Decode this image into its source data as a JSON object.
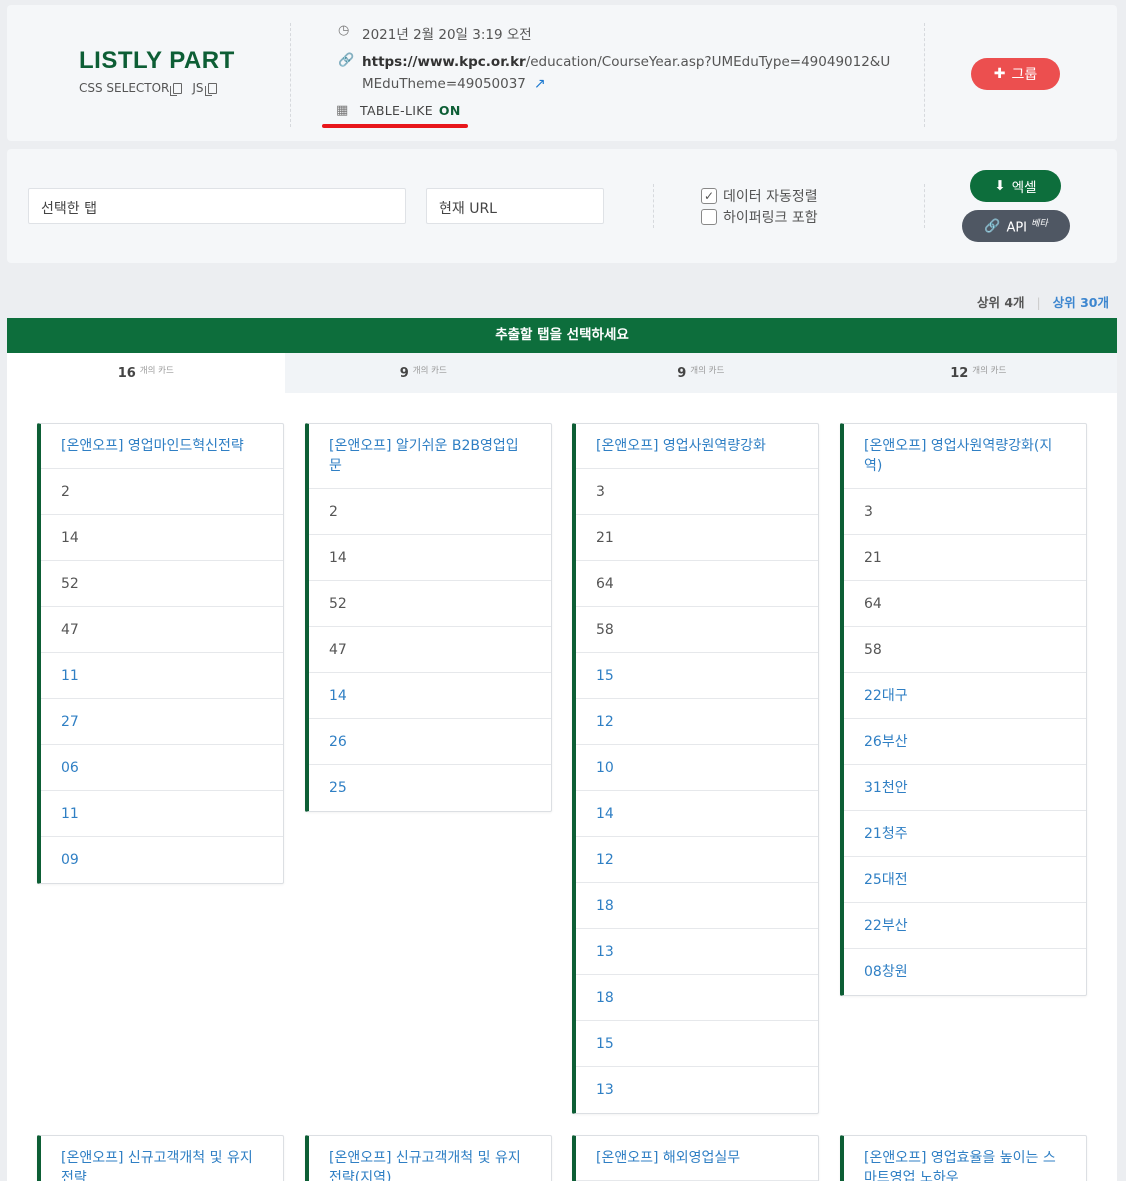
{
  "brand": {
    "title": "LISTLY  PART",
    "css_selector": "CSS SELECTOR",
    "js": "JS"
  },
  "info": {
    "datetime": "2021년 2월 20일 3:19 오전",
    "url_host": "https://www.kpc.or.kr",
    "url_path": "/education/CourseYear.asp?UMEduType=49049012&UMEduTheme=49050037",
    "table_like_label": "TABLE-LIKE",
    "table_like_state": "ON"
  },
  "group_button": "그룹",
  "selected_tab_field": "선택한 탭",
  "current_url_field": "현재 URL",
  "options": {
    "auto_sort": "데이터 자동정렬",
    "auto_sort_checked": true,
    "hyperlink": "하이퍼링크 포함",
    "hyperlink_checked": false
  },
  "excel_button": "엑셀",
  "api_button": "API",
  "api_beta": "베타",
  "top_links": {
    "top4": "상위 4개",
    "top30": "상위 30개"
  },
  "green_bar": "추출할 탭을 선택하세요",
  "tabs": [
    {
      "count": "16",
      "suffix": "개의 카드"
    },
    {
      "count": "9",
      "suffix": "개의 카드"
    },
    {
      "count": "9",
      "suffix": "개의 카드"
    },
    {
      "count": "12",
      "suffix": "개의 카드"
    }
  ],
  "cards": [
    {
      "title": "[온앤오프] 영업마인드혁신전략",
      "rows": [
        {
          "t": "2",
          "link": false
        },
        {
          "t": "14",
          "link": false
        },
        {
          "t": "52",
          "link": false
        },
        {
          "t": "47",
          "link": false
        },
        {
          "t": "11",
          "link": true
        },
        {
          "t": "27",
          "link": true
        },
        {
          "t": "06",
          "link": true
        },
        {
          "t": "11",
          "link": true
        },
        {
          "t": "09",
          "link": true
        }
      ]
    },
    {
      "title": "[온앤오프] 알기쉬운 B2B영업입문",
      "rows": [
        {
          "t": "2",
          "link": false
        },
        {
          "t": "14",
          "link": false
        },
        {
          "t": "52",
          "link": false
        },
        {
          "t": "47",
          "link": false
        },
        {
          "t": "14",
          "link": true
        },
        {
          "t": "26",
          "link": true
        },
        {
          "t": "25",
          "link": true
        }
      ]
    },
    {
      "title": "[온앤오프] 영업사원역량강화",
      "rows": [
        {
          "t": "3",
          "link": false
        },
        {
          "t": "21",
          "link": false
        },
        {
          "t": "64",
          "link": false
        },
        {
          "t": "58",
          "link": false
        },
        {
          "t": "15",
          "link": true
        },
        {
          "t": "12",
          "link": true
        },
        {
          "t": "10",
          "link": true
        },
        {
          "t": "14",
          "link": true
        },
        {
          "t": "12",
          "link": true
        },
        {
          "t": "18",
          "link": true
        },
        {
          "t": "13",
          "link": true
        },
        {
          "t": "18",
          "link": true
        },
        {
          "t": "15",
          "link": true
        },
        {
          "t": "13",
          "link": true
        }
      ]
    },
    {
      "title": "[온앤오프] 영업사원역량강화(지역)",
      "rows": [
        {
          "t": "3",
          "link": false
        },
        {
          "t": "21",
          "link": false
        },
        {
          "t": "64",
          "link": false
        },
        {
          "t": "58",
          "link": false
        },
        {
          "t": "22대구",
          "link": true
        },
        {
          "t": "26부산",
          "link": true
        },
        {
          "t": "31천안",
          "link": true
        },
        {
          "t": "21청주",
          "link": true
        },
        {
          "t": "25대전",
          "link": true
        },
        {
          "t": "22부산",
          "link": true
        },
        {
          "t": "08창원",
          "link": true
        }
      ]
    },
    {
      "title": "[온앤오프] 신규고객개척 및 유지전략",
      "rows": []
    },
    {
      "title": "[온앤오프] 신규고객개척 및 유지전략(지역)",
      "rows": []
    },
    {
      "title": "[온앤오프] 해외영업실무",
      "rows": []
    },
    {
      "title": "[온앤오프] 영업효율을 높이는 스마트영업 노하우",
      "rows": []
    }
  ]
}
